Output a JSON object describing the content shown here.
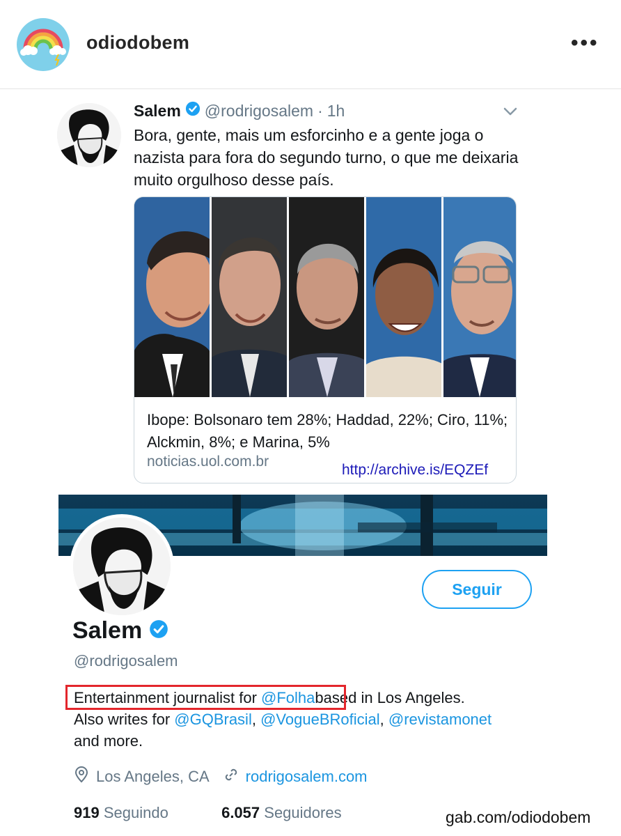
{
  "post": {
    "username": "odiodobem",
    "more_icon": "more-horizontal-icon"
  },
  "tweet": {
    "name": "Salem",
    "handle": "@rodrigosalem",
    "separator": "·",
    "time": "1h",
    "text": "Bora, gente, mais um esforcinho e a gente joga o nazista para fora do segundo turno, o que me deixaria muito orgulhoso desse país.",
    "card": {
      "title": "Ibope: Bolsonaro tem 28%; Haddad, 22%; Ciro, 11%; Alckmin, 8%; e Marina, 5%",
      "domain": "noticias.uol.com.br"
    },
    "archive_link": "http://archive.is/EQZEf"
  },
  "profile": {
    "name": "Salem",
    "handle": "@rodrigosalem",
    "follow_label": "Seguir",
    "bio": {
      "part1": "Entertainment journalist for ",
      "mention1": "@Folha",
      "part2": "based in Los Angeles.",
      "part3": "Also writes for ",
      "mention2": "@GQBrasil",
      "comma1": ", ",
      "mention3": "@VogueBRoficial",
      "comma2": ", ",
      "mention4": "@revistamonet",
      "part4": "and more."
    },
    "location": "Los Angeles, CA",
    "website": "rodrigosalem.com",
    "following_count": "919",
    "following_label": "Seguindo",
    "followers_count": "6.057",
    "followers_label": "Seguidores"
  },
  "watermark": "gab.com/odiodobem",
  "colors": {
    "twitter_blue": "#1da1f2",
    "link_blue": "#1b95e0",
    "highlight_red": "#e3262c",
    "archive_link": "#1c1ab8"
  }
}
